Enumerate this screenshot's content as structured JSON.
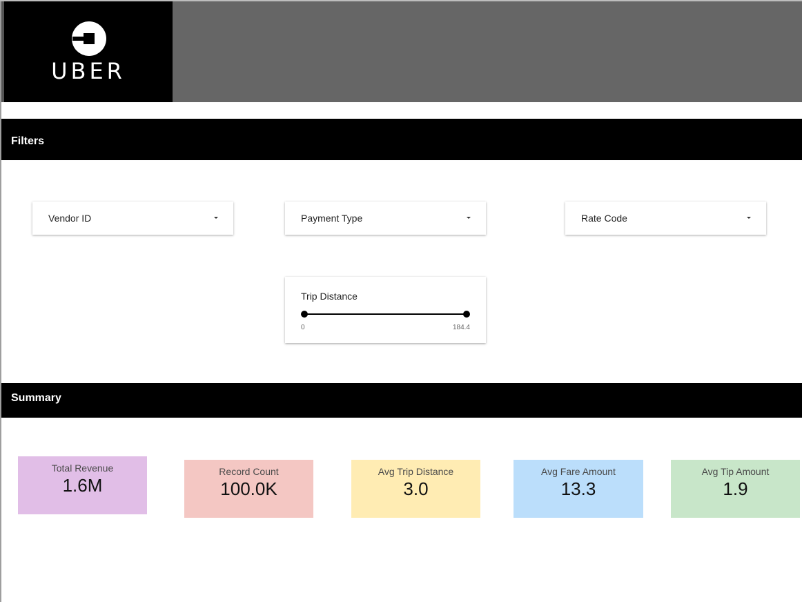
{
  "brand": {
    "name": "UBER",
    "logo_bg": "#000000",
    "header_bg": "#666666"
  },
  "sections": {
    "filters_title": "Filters",
    "summary_title": "Summary"
  },
  "filters": {
    "vendor": {
      "label": "Vendor ID"
    },
    "payment": {
      "label": "Payment Type"
    },
    "rate": {
      "label": "Rate Code"
    },
    "trip_distance": {
      "label": "Trip Distance",
      "min_label": "0",
      "max_label": "184.4"
    }
  },
  "scorecards": [
    {
      "label": "Total Revenue",
      "value": "1.6M",
      "color": "#e1bee7"
    },
    {
      "label": "Record Count",
      "value": "100.0K",
      "color": "#f4c7c3"
    },
    {
      "label": "Avg Trip Distance",
      "value": "3.0",
      "color": "#ffecb3"
    },
    {
      "label": "Avg Fare Amount",
      "value": "13.3",
      "color": "#bbdefb"
    },
    {
      "label": "Avg Tip Amount",
      "value": "1.9",
      "color": "#c8e6c9"
    }
  ]
}
